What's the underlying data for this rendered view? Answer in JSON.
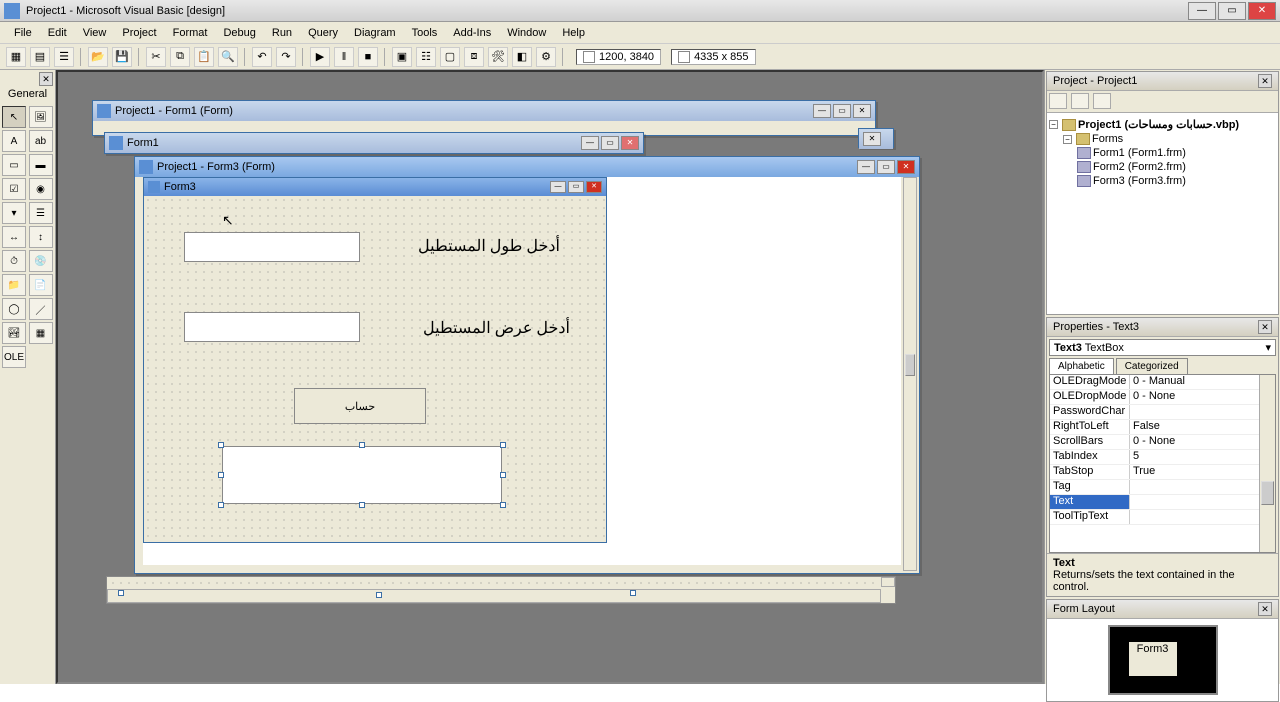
{
  "app": {
    "title": "Project1 - Microsoft Visual Basic [design]"
  },
  "menus": [
    "File",
    "Edit",
    "View",
    "Project",
    "Format",
    "Debug",
    "Run",
    "Query",
    "Diagram",
    "Tools",
    "Add-Ins",
    "Window",
    "Help"
  ],
  "status": {
    "coords": "1200, 3840",
    "size": "4335 x 855"
  },
  "toolbox": {
    "title": "General"
  },
  "project_panel": {
    "title": "Project - Project1",
    "root": "Project1 (حسابات ومساحات.vbp)",
    "folder": "Forms",
    "forms": [
      "Form1 (Form1.frm)",
      "Form2 (Form2.frm)",
      "Form3 (Form3.frm)"
    ]
  },
  "properties_panel": {
    "title": "Properties - Text3",
    "object_name": "Text3",
    "object_type": "TextBox",
    "tabs": [
      "Alphabetic",
      "Categorized"
    ],
    "rows": [
      {
        "k": "OLEDragMode",
        "v": "0 - Manual"
      },
      {
        "k": "OLEDropMode",
        "v": "0 - None"
      },
      {
        "k": "PasswordChar",
        "v": ""
      },
      {
        "k": "RightToLeft",
        "v": "False"
      },
      {
        "k": "ScrollBars",
        "v": "0 - None"
      },
      {
        "k": "TabIndex",
        "v": "5"
      },
      {
        "k": "TabStop",
        "v": "True"
      },
      {
        "k": "Tag",
        "v": ""
      },
      {
        "k": "Text",
        "v": "",
        "sel": true
      },
      {
        "k": "ToolTipText",
        "v": ""
      }
    ],
    "desc_title": "Text",
    "desc_body": "Returns/sets the text contained in the control."
  },
  "form_layout": {
    "title": "Form Layout",
    "form_label": "Form3"
  },
  "mdi": {
    "win1": {
      "title": "Project1 - Form1 (Form)"
    },
    "win_form1": {
      "title": "Form1"
    },
    "win3": {
      "title": "Project1 - Form3 (Form)"
    },
    "form3": {
      "title": "Form3",
      "label1": "أدخل طول المستطيل",
      "label2": "أدخل عرض المستطيل",
      "button": "حساب"
    }
  }
}
